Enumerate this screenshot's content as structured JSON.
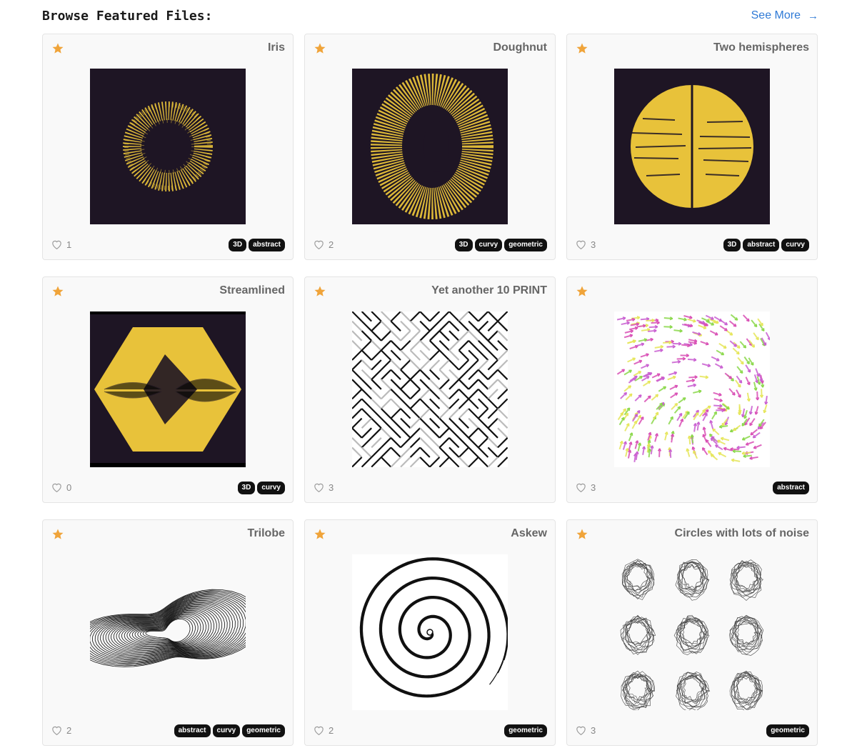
{
  "header": {
    "title": "Browse Featured Files:",
    "see_more": "See More"
  },
  "colors": {
    "accent_link": "#2f7ad6",
    "star": "#f0a43a",
    "thumb_dark": "#1e1524",
    "thumb_yellow": "#e8c23a"
  },
  "cards": [
    {
      "title": "Iris",
      "likes": "1",
      "tags": [
        "3D",
        "abstract"
      ]
    },
    {
      "title": "Doughnut",
      "likes": "2",
      "tags": [
        "3D",
        "curvy",
        "geometric"
      ]
    },
    {
      "title": "Two hemispheres",
      "likes": "3",
      "tags": [
        "3D",
        "abstract",
        "curvy"
      ]
    },
    {
      "title": "Streamlined",
      "likes": "0",
      "tags": [
        "3D",
        "curvy"
      ]
    },
    {
      "title": "Yet another 10 PRINT",
      "likes": "3",
      "tags": []
    },
    {
      "title": "",
      "likes": "3",
      "tags": [
        "abstract"
      ]
    },
    {
      "title": "Trilobe",
      "likes": "2",
      "tags": [
        "abstract",
        "curvy",
        "geometric"
      ]
    },
    {
      "title": "Askew",
      "likes": "2",
      "tags": [
        "geometric"
      ]
    },
    {
      "title": "Circles with lots of noise",
      "likes": "3",
      "tags": [
        "geometric"
      ]
    }
  ],
  "icons": {
    "star": "star-icon",
    "heart": "heart-icon",
    "arrow": "arrow-right-icon"
  }
}
